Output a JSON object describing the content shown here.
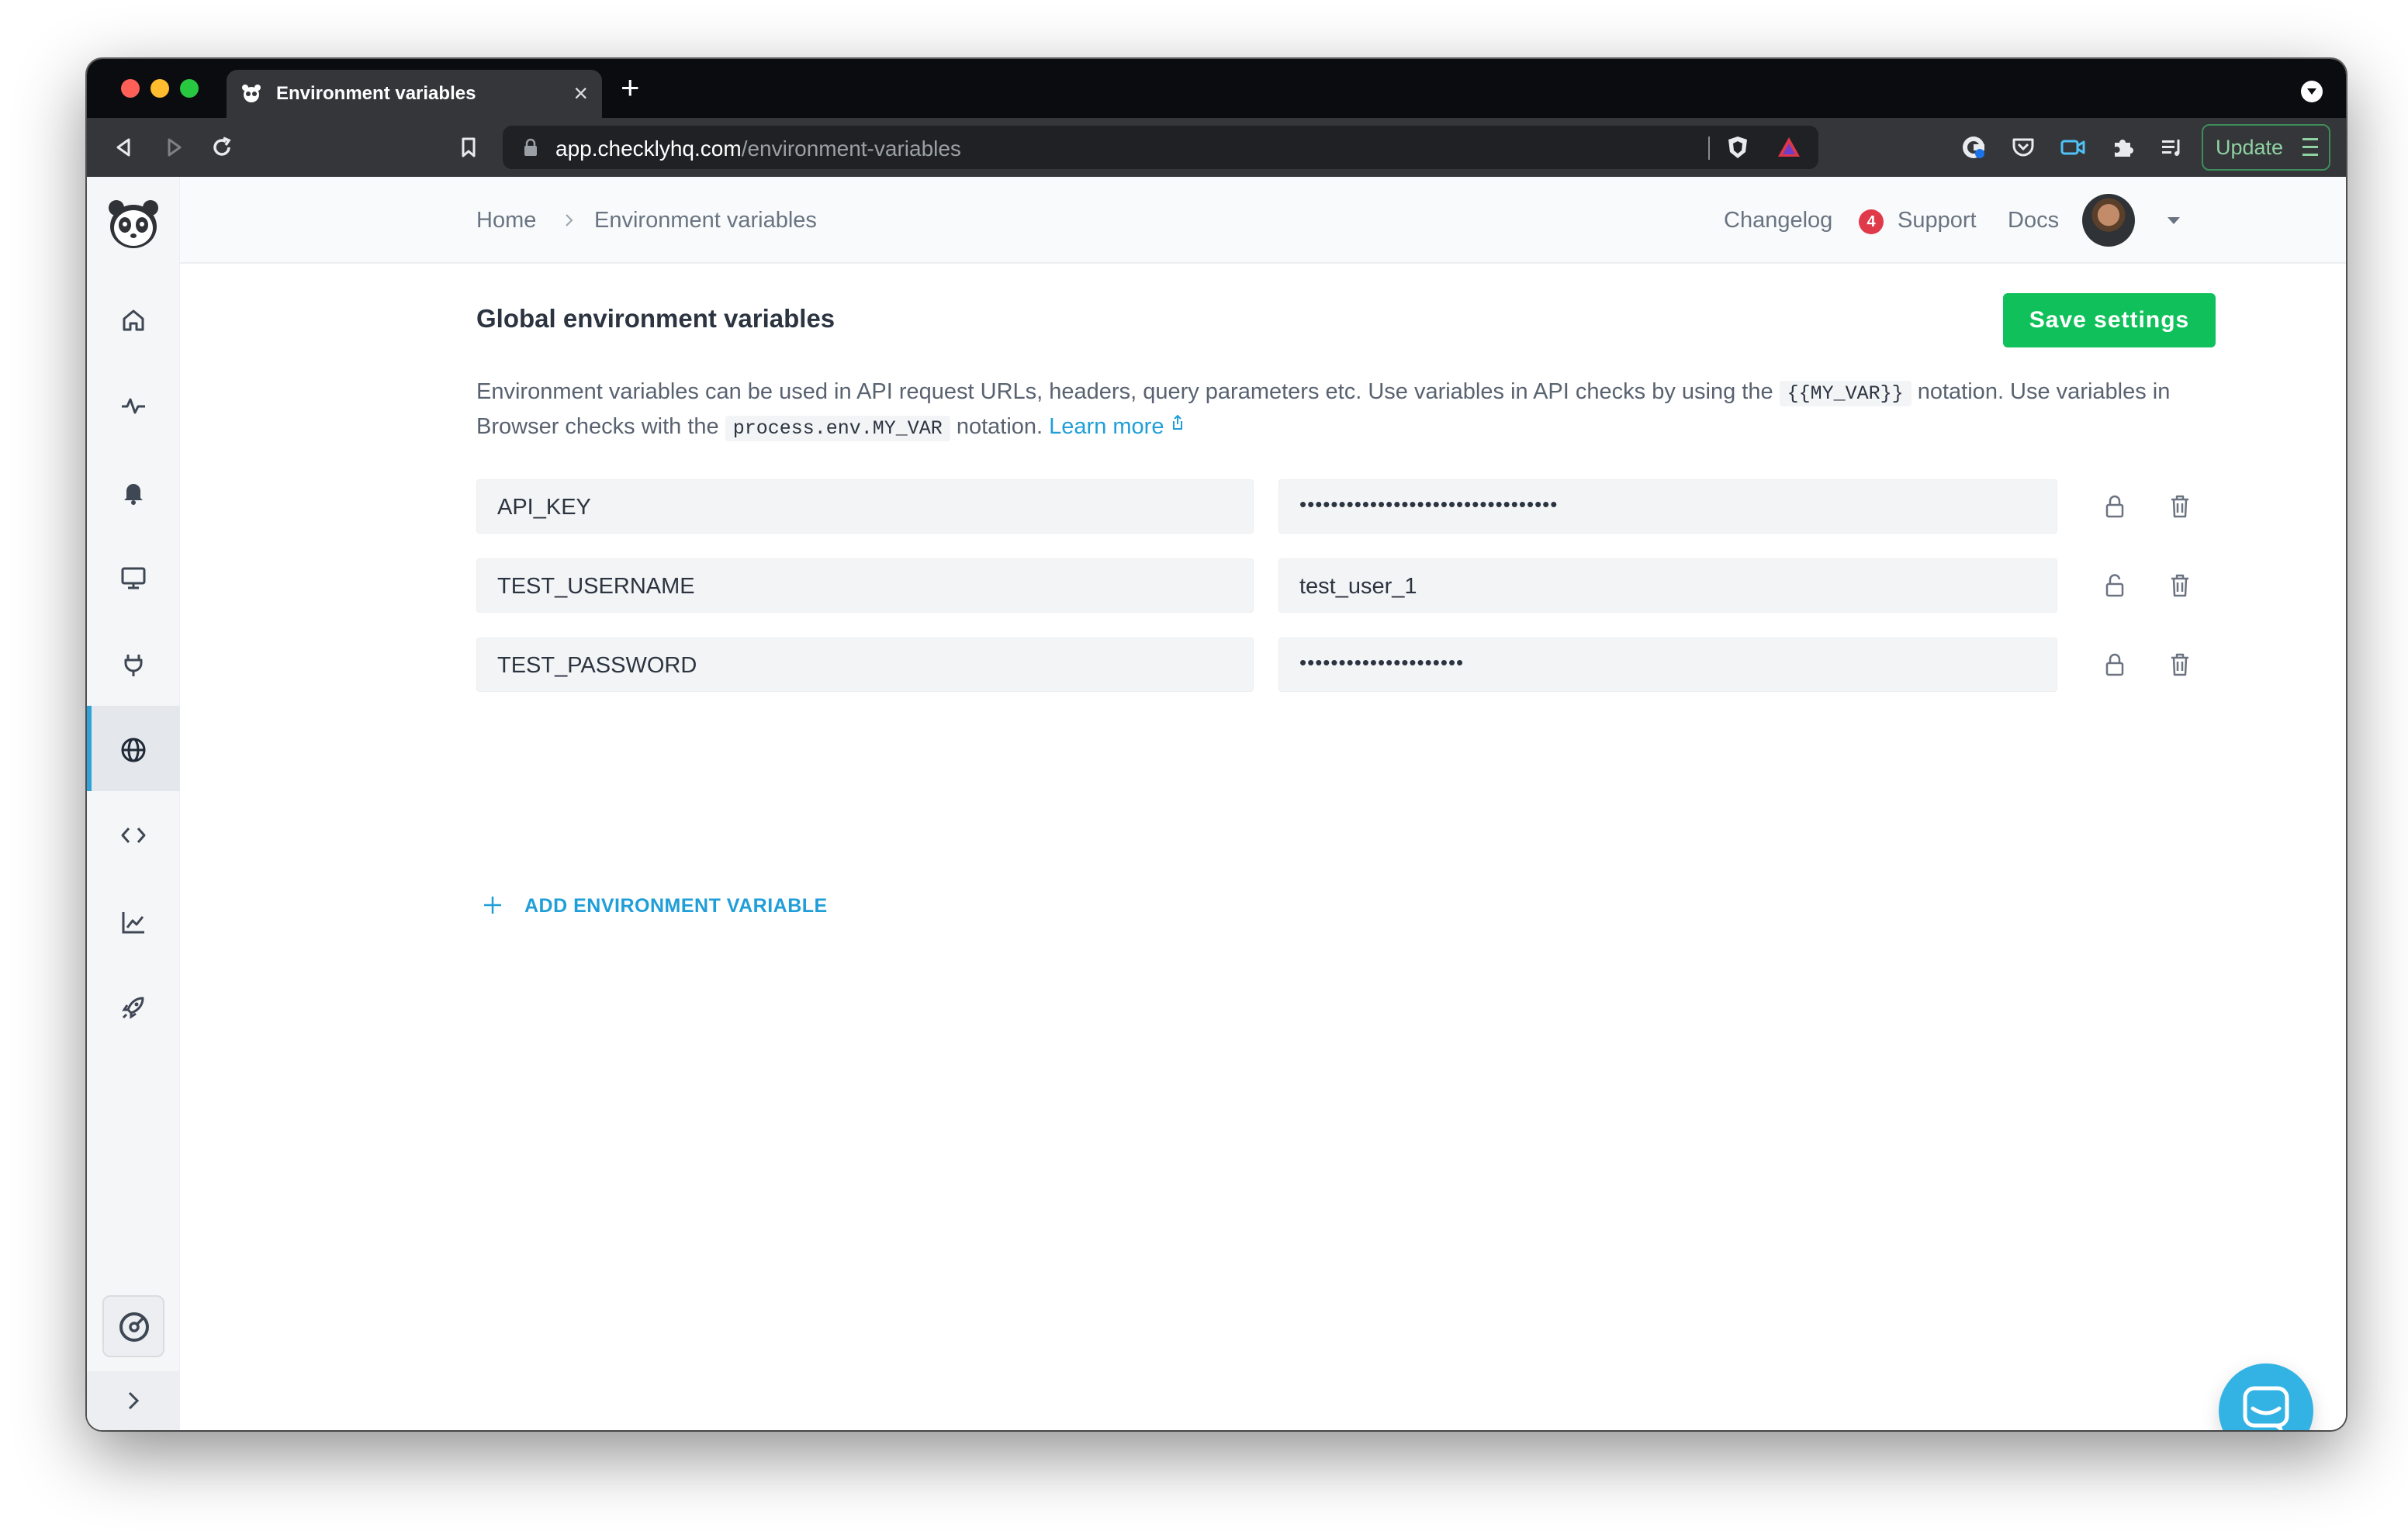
{
  "browser": {
    "tab_title": "Environment variables",
    "tab_close": "×",
    "new_tab": "+",
    "url_domain": "app.checklyhq.com",
    "url_path": "/environment-variables",
    "update_label": "Update"
  },
  "header": {
    "breadcrumb_home": "Home",
    "breadcrumb_current": "Environment variables",
    "changelog": "Changelog",
    "changelog_count": "4",
    "support": "Support",
    "docs": "Docs"
  },
  "page": {
    "title": "Global environment variables",
    "save_label": "Save settings",
    "desc_part1": "Environment variables can be used in API request URLs, headers, query parameters etc. Use variables in API checks by using the ",
    "desc_code1": "{{MY_VAR}}",
    "desc_part2": " notation. Use variables in Browser checks with the ",
    "desc_code2": "process.env.MY_VAR",
    "desc_part3": " notation. ",
    "learn_more": "Learn more",
    "add_label": "ADD ENVIRONMENT VARIABLE"
  },
  "variables": [
    {
      "key": "API_KEY",
      "value": "•••••••••••••••••••••••••••••••••",
      "locked": true
    },
    {
      "key": "TEST_USERNAME",
      "value": "test_user_1",
      "locked": false
    },
    {
      "key": "TEST_PASSWORD",
      "value": "•••••••••••••••••••••",
      "locked": true
    }
  ],
  "sidebar": {
    "items": [
      "home-icon",
      "activity-icon",
      "bell-icon",
      "monitor-icon",
      "plug-icon",
      "globe-icon",
      "code-icon",
      "chart-icon",
      "rocket-icon"
    ],
    "active": "globe-icon"
  },
  "colors": {
    "accent": "#2ea2d9",
    "save_button": "#10c15b",
    "badge": "#e03a4a",
    "chat": "#33b3e4"
  }
}
